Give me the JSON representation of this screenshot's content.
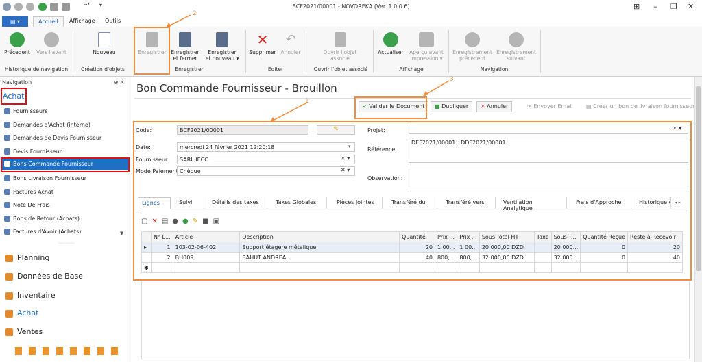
{
  "window": {
    "title": "BCF2021/00001 - NOVOREKA (Ver. 1.0.0.6)"
  },
  "tabs": {
    "file": "▤ ▾",
    "accueil": "Accueil",
    "affichage": "Affichage",
    "outils": "Outils"
  },
  "ribbon": {
    "precedent": "Précedent",
    "vers_avant": "Vers l'avant",
    "nouveau": "Nouveau",
    "enregistrer": "Enregistrer",
    "enreg_fermer_1": "Enregistrer",
    "enreg_fermer_2": "et fermer",
    "enreg_nouveau_1": "Enregistrer",
    "enreg_nouveau_2": "et nouveau ▾",
    "supprimer": "Supprimer",
    "annuler": "Annuler",
    "ouvrir_obj_1": "Ouvrir l'objet",
    "ouvrir_obj_2": "associé",
    "actualiser": "Actualiser",
    "apercu_1": "Aperçu avant",
    "apercu_2": "impression ▾",
    "enreg_prec_1": "Enregistrement",
    "enreg_prec_2": "précedent",
    "enreg_suiv_1": "Enregistrement",
    "enreg_suiv_2": "suivant",
    "grp_hist": "Historique de navigation",
    "grp_creation": "Création d'objets",
    "grp_enreg": "Enregistrer",
    "grp_editer": "Editer",
    "grp_ouvrir": "Ouvrir l'objet associé",
    "grp_affichage": "Affichage",
    "grp_navigation": "Navigation"
  },
  "annotations": {
    "n1": "1",
    "n2": "2",
    "n3": "3"
  },
  "nav": {
    "header": "Navigation",
    "pin": "⊕ ✕",
    "section": "Achat",
    "items": [
      "Fournisseurs",
      "Demandes d'Achat (interne)",
      "Demandes de Devis Fournisseur",
      "Devis Fournisseur",
      "Bons Commande Fournisseur",
      "Bons Livraison Fournisseur",
      "Factures Achat",
      "Note De Frais",
      "Bons de Retour (Achats)",
      "Factures d'Avoir (Achats)"
    ],
    "more": "⋯⋯⋯⋯",
    "big": [
      "Planning",
      "Données de Base",
      "Inventaire",
      "Achat",
      "Ventes"
    ]
  },
  "doc": {
    "title": "Bon Commande Fournisseur - Brouillon",
    "actions": {
      "valider": "Valider le Document",
      "dupliquer": "Dupliquer",
      "annuler": "Annuler",
      "email": "Envoyer Email",
      "livraison": "Créer un bon de livraison fournisseur"
    },
    "code_label": "Code:",
    "code": "BCF2021/00001",
    "date_label": "Date:",
    "date": "mercredi 24 février 2021 12:20:18",
    "fournisseur_label": "Fournisseur:",
    "fournisseur": "SARL IECO",
    "mode_label": "Mode Paiement:",
    "mode": "Chèque",
    "projet_label": "Projet:",
    "projet": "",
    "reference_label": "Référence:",
    "reference": "DEF2021/00001 : DDF2021/00001 :",
    "observation_label": "Observation:",
    "observation": ""
  },
  "subtabs": [
    "Lignes",
    "Suivi",
    "Détails des taxes",
    "Taxes Globales",
    "Pièces Jointes",
    "Transféré du",
    "Transféré vers",
    "Ventilation Analytique",
    "Frais d'Approche",
    "Historique de"
  ],
  "grid": {
    "headers": [
      "N° L...",
      "Article",
      "Description",
      "Quantité",
      "Prix ...",
      "Prix ...",
      "Sous-Total HT",
      "Taxe",
      "Sous-T...",
      "Quantité Reçue",
      "Reste à Recevoir"
    ],
    "rows": [
      [
        "1",
        "103-02-06-402",
        "Support étagere métalique",
        "20",
        "1 00...",
        "1 00...",
        "20 000,00 DZD",
        "",
        "20 000...",
        "0",
        "20"
      ],
      [
        "2",
        "BH009",
        "BAHUT ANDREA",
        "40",
        "800,...",
        "800,...",
        "32 000,00 DZD",
        "",
        "32 000...",
        "0",
        "40"
      ]
    ]
  }
}
